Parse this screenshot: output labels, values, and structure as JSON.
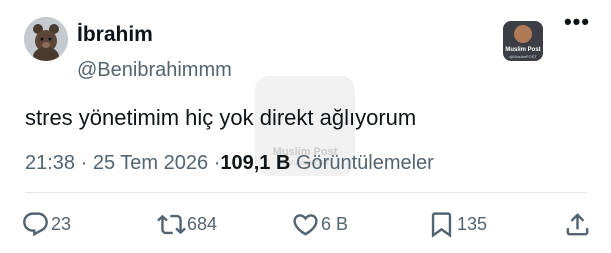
{
  "author": {
    "display_name": "İbrahim",
    "handle": "@Benibrahimmm"
  },
  "source_badge": {
    "name": "Muslim Post",
    "handle": "@MuslimPOST"
  },
  "tweet": {
    "text": "stres yönetimim hiç yok direkt ağlıyorum",
    "time": "21:38",
    "separator": "·",
    "date": "25 Tem 2026",
    "views_count": "109,1 B",
    "views_label": "Görüntülemeler"
  },
  "actions": {
    "replies": "23",
    "reposts": "684",
    "likes": "6 B",
    "bookmarks": "135"
  },
  "icons": {
    "more": "more-dots-icon",
    "reply": "reply-icon",
    "repost": "repost-icon",
    "like": "heart-icon",
    "bookmark": "bookmark-icon",
    "share": "share-icon"
  },
  "colors": {
    "text": "#0f1419",
    "secondary": "#536471",
    "divider": "#e1e6ea"
  }
}
